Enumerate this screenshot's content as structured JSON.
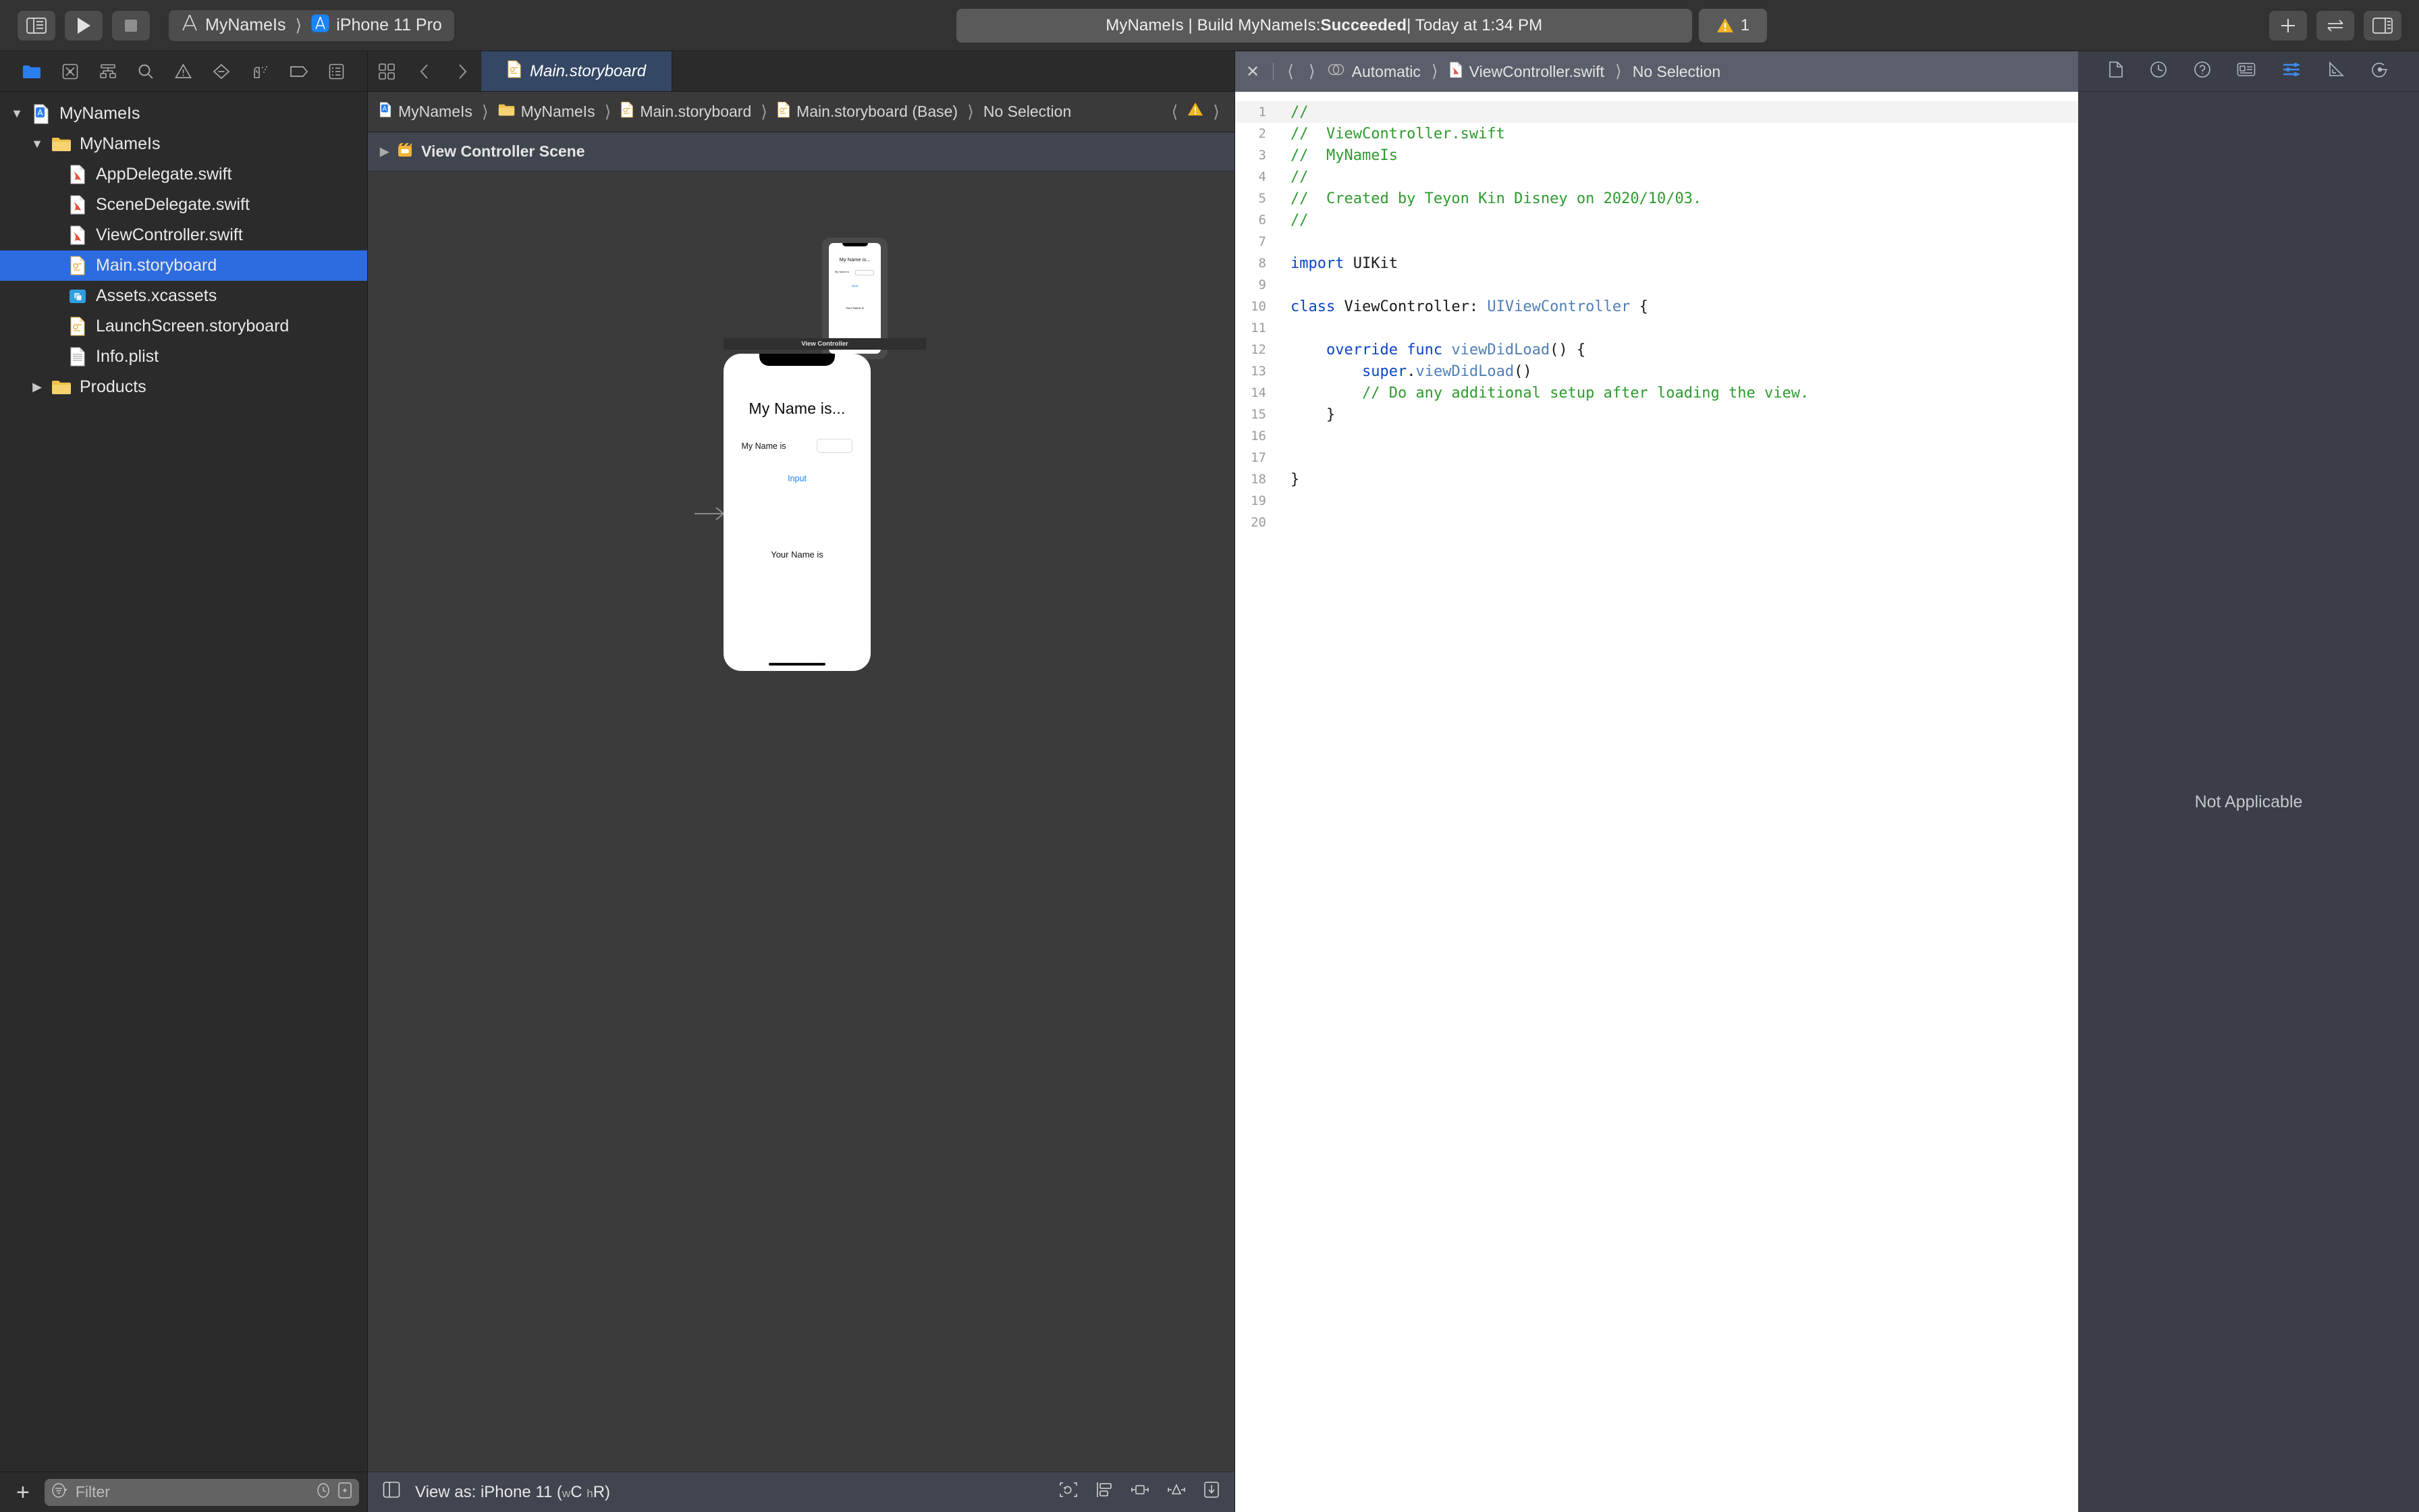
{
  "toolbar": {
    "sidebar_toggle": "sidebar-toggle",
    "run_label": "Run",
    "stop_label": "Stop",
    "scheme_project": "MyNameIs",
    "scheme_destination": "iPhone 11 Pro",
    "status_prefix": "MyNameIs | Build MyNameIs: ",
    "status_result": "Succeeded",
    "status_suffix": " | Today at 1:34 PM",
    "warning_count": "1",
    "add_label": "+",
    "swap_label": "swap-editors",
    "inspector_toggle": "inspector-toggle"
  },
  "navigator": {
    "tabs": [
      {
        "name": "project-navigator",
        "active": true
      },
      {
        "name": "source-control-navigator",
        "active": false
      },
      {
        "name": "symbol-navigator",
        "active": false
      },
      {
        "name": "find-navigator",
        "active": false
      },
      {
        "name": "issue-navigator",
        "active": false
      },
      {
        "name": "test-navigator",
        "active": false
      },
      {
        "name": "debug-navigator",
        "active": false
      },
      {
        "name": "breakpoint-navigator",
        "active": false
      },
      {
        "name": "report-navigator",
        "active": false
      }
    ],
    "tree": [
      {
        "label": "MyNameIs",
        "icon": "project-icon",
        "depth": 0,
        "twisty": "down",
        "selected": false
      },
      {
        "label": "MyNameIs",
        "icon": "folder-icon",
        "depth": 1,
        "twisty": "down",
        "selected": false
      },
      {
        "label": "AppDelegate.swift",
        "icon": "swift-file-icon",
        "depth": 2,
        "twisty": "none",
        "selected": false
      },
      {
        "label": "SceneDelegate.swift",
        "icon": "swift-file-icon",
        "depth": 2,
        "twisty": "none",
        "selected": false
      },
      {
        "label": "ViewController.swift",
        "icon": "swift-file-icon",
        "depth": 2,
        "twisty": "none",
        "selected": false
      },
      {
        "label": "Main.storyboard",
        "icon": "storyboard-file-icon",
        "depth": 2,
        "twisty": "none",
        "selected": true
      },
      {
        "label": "Assets.xcassets",
        "icon": "assets-icon",
        "depth": 2,
        "twisty": "none",
        "selected": false
      },
      {
        "label": "LaunchScreen.storyboard",
        "icon": "storyboard-file-icon",
        "depth": 2,
        "twisty": "none",
        "selected": false
      },
      {
        "label": "Info.plist",
        "icon": "plist-file-icon",
        "depth": 2,
        "twisty": "none",
        "selected": false
      },
      {
        "label": "Products",
        "icon": "folder-icon",
        "depth": 1,
        "twisty": "right",
        "selected": false
      }
    ],
    "filter_placeholder": "Filter",
    "add_button": "+"
  },
  "storyboard_editor": {
    "tab_label": "Main.storyboard",
    "breadcrumb": [
      "MyNameIs",
      "MyNameIs",
      "Main.storyboard",
      "Main.storyboard (Base)",
      "No Selection"
    ],
    "outline_item": "View Controller Scene",
    "scene_label": "View Controller",
    "device_preview": {
      "title": "My Name is...",
      "field_label": "My Name is",
      "textfield_value": "",
      "button_label": "Input",
      "output_label": "Your Name is"
    },
    "statusbar": {
      "view_as_prefix": "View as: iPhone 11 (",
      "view_as_w": "w",
      "view_as_wc": "C",
      "view_as_h": "h",
      "view_as_hr": "R",
      "view_as_suffix": ")"
    }
  },
  "code_editor": {
    "breadcrumb": [
      "Automatic",
      "ViewController.swift",
      "No Selection"
    ],
    "close_label": "✕",
    "lines": [
      {
        "n": "1",
        "tokens": [
          {
            "t": "//",
            "c": "c-com"
          }
        ]
      },
      {
        "n": "2",
        "tokens": [
          {
            "t": "//  ViewController.swift",
            "c": "c-com"
          }
        ]
      },
      {
        "n": "3",
        "tokens": [
          {
            "t": "//  MyNameIs",
            "c": "c-com"
          }
        ]
      },
      {
        "n": "4",
        "tokens": [
          {
            "t": "//",
            "c": "c-com"
          }
        ]
      },
      {
        "n": "5",
        "tokens": [
          {
            "t": "//  Created by Teyon Kin Disney on 2020/10/03.",
            "c": "c-com"
          }
        ]
      },
      {
        "n": "6",
        "tokens": [
          {
            "t": "//",
            "c": "c-com"
          }
        ]
      },
      {
        "n": "7",
        "tokens": []
      },
      {
        "n": "8",
        "tokens": [
          {
            "t": "import",
            "c": "c-kw"
          },
          {
            "t": " UIKit",
            "c": "c-pln"
          }
        ]
      },
      {
        "n": "9",
        "tokens": []
      },
      {
        "n": "10",
        "tokens": [
          {
            "t": "class",
            "c": "c-kw"
          },
          {
            "t": " ViewController",
            "c": "c-pln"
          },
          {
            "t": ": ",
            "c": "c-pln"
          },
          {
            "t": "UIViewController",
            "c": "c-typ"
          },
          {
            "t": " {",
            "c": "c-pln"
          }
        ]
      },
      {
        "n": "11",
        "tokens": []
      },
      {
        "n": "12",
        "tokens": [
          {
            "t": "    ",
            "c": "c-pln"
          },
          {
            "t": "override func",
            "c": "c-kw"
          },
          {
            "t": " ",
            "c": "c-pln"
          },
          {
            "t": "viewDidLoad",
            "c": "c-fn"
          },
          {
            "t": "() {",
            "c": "c-pln"
          }
        ]
      },
      {
        "n": "13",
        "tokens": [
          {
            "t": "        ",
            "c": "c-pln"
          },
          {
            "t": "super",
            "c": "c-kw"
          },
          {
            "t": ".",
            "c": "c-pln"
          },
          {
            "t": "viewDidLoad",
            "c": "c-fn"
          },
          {
            "t": "()",
            "c": "c-pln"
          }
        ]
      },
      {
        "n": "14",
        "tokens": [
          {
            "t": "        // Do any additional setup after loading the view.",
            "c": "c-com"
          }
        ]
      },
      {
        "n": "15",
        "tokens": [
          {
            "t": "    }",
            "c": "c-pln"
          }
        ]
      },
      {
        "n": "16",
        "tokens": []
      },
      {
        "n": "17",
        "tokens": []
      },
      {
        "n": "18",
        "tokens": [
          {
            "t": "}",
            "c": "c-pln"
          }
        ]
      },
      {
        "n": "19",
        "tokens": []
      },
      {
        "n": "20",
        "tokens": []
      }
    ]
  },
  "inspector": {
    "tabs": [
      {
        "name": "file-inspector",
        "active": false
      },
      {
        "name": "history-inspector",
        "active": false
      },
      {
        "name": "quick-help-inspector",
        "active": false
      },
      {
        "name": "identity-inspector",
        "active": false
      },
      {
        "name": "attributes-inspector",
        "active": true
      },
      {
        "name": "size-inspector",
        "active": false
      },
      {
        "name": "connections-inspector",
        "active": false
      }
    ],
    "empty_message": "Not Applicable"
  },
  "colors": {
    "accent_blue": "#2d6ce0",
    "tint_blue": "#3d8bf2",
    "warning_yellow": "#f0b323",
    "comment_green": "#2d9b2d",
    "keyword_blue": "#0b44c8",
    "type_blue": "#4f7fb5",
    "ios_link_blue": "#1a84ff"
  }
}
